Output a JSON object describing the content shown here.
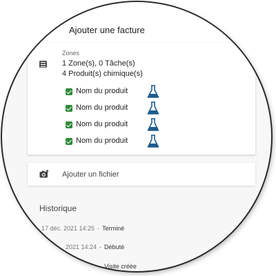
{
  "header": {
    "add_invoice_label": "Ajouter une facture"
  },
  "card": {
    "zones_label": "Zones",
    "summary_line1": "1 Zone(s), 0 Tâche(s)",
    "summary_line2": "4 Produit(s) chimique(s)",
    "products": [
      {
        "name": "Nom du produit",
        "checked": true,
        "icon": "flask-icon"
      },
      {
        "name": "Nom du produit",
        "checked": true,
        "icon": "flask-icon"
      },
      {
        "name": "Nom du produit",
        "checked": true,
        "icon": "flask-icon"
      },
      {
        "name": "Nom du produit",
        "checked": true,
        "icon": "flask-icon"
      }
    ]
  },
  "file": {
    "add_file_label": "Ajouter un fichier",
    "icon": "add-photo-icon"
  },
  "history": {
    "title": "Historique",
    "entries": [
      {
        "date": "17 déc. 2021 14:25",
        "separator": "-",
        "status": "Terminé"
      },
      {
        "date": "2021 14:24",
        "separator": "-",
        "status": "Débuté"
      },
      {
        "date": "",
        "separator": "-",
        "status": "Visite créée"
      }
    ]
  },
  "colors": {
    "check_green": "#2f8a3a",
    "flask_blue": "#1f5c8e"
  }
}
